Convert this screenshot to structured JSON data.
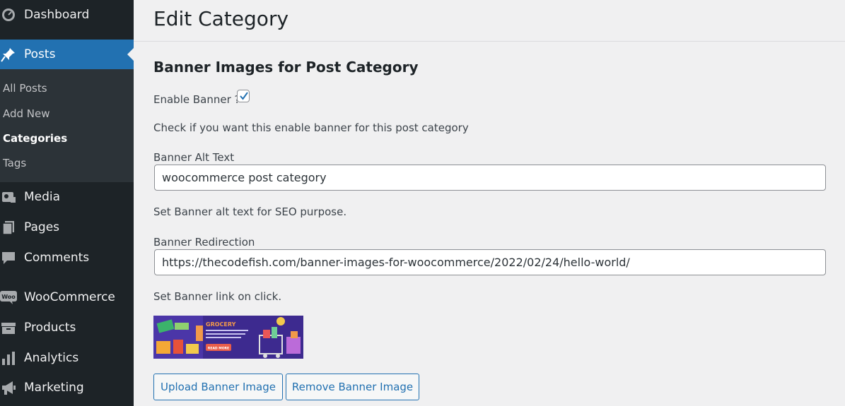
{
  "sidebar": {
    "items": [
      {
        "label": "Dashboard",
        "icon": "dashboard-icon"
      },
      {
        "label": "Posts",
        "icon": "pin-icon"
      },
      {
        "label": "Media",
        "icon": "media-icon"
      },
      {
        "label": "Pages",
        "icon": "pages-icon"
      },
      {
        "label": "Comments",
        "icon": "comments-icon"
      },
      {
        "label": "WooCommerce",
        "icon": "woocommerce-icon"
      },
      {
        "label": "Products",
        "icon": "products-icon"
      },
      {
        "label": "Analytics",
        "icon": "analytics-icon"
      },
      {
        "label": "Marketing",
        "icon": "megaphone-icon"
      }
    ],
    "submenu": [
      "All Posts",
      "Add New",
      "Categories",
      "Tags"
    ],
    "woo_badge": "Woo"
  },
  "page": {
    "title": "Edit Category",
    "section_title": "Banner Images for Post Category",
    "enable_banner_label": "Enable Banner ?",
    "enable_banner_checked": true,
    "enable_banner_help": "Check if you want this enable banner for this post category",
    "alt_text_label": "Banner Alt Text",
    "alt_text_value": "woocommerce post category",
    "alt_text_help": "Set Banner alt text for SEO purpose.",
    "redirection_label": "Banner Redirection",
    "redirection_value": "https://thecodefish.com/banner-images-for-woocommerce/2022/02/24/hello-world/",
    "redirection_help": "Set Banner link on click.",
    "banner": {
      "heading": "GROCERY",
      "cta": "READ MORE"
    },
    "upload_button": "Upload Banner Image",
    "remove_button": "Remove Banner Image"
  },
  "colors": {
    "sidebar_bg": "#1d2327",
    "active": "#2271b1",
    "page_bg": "#f0f0f1"
  }
}
